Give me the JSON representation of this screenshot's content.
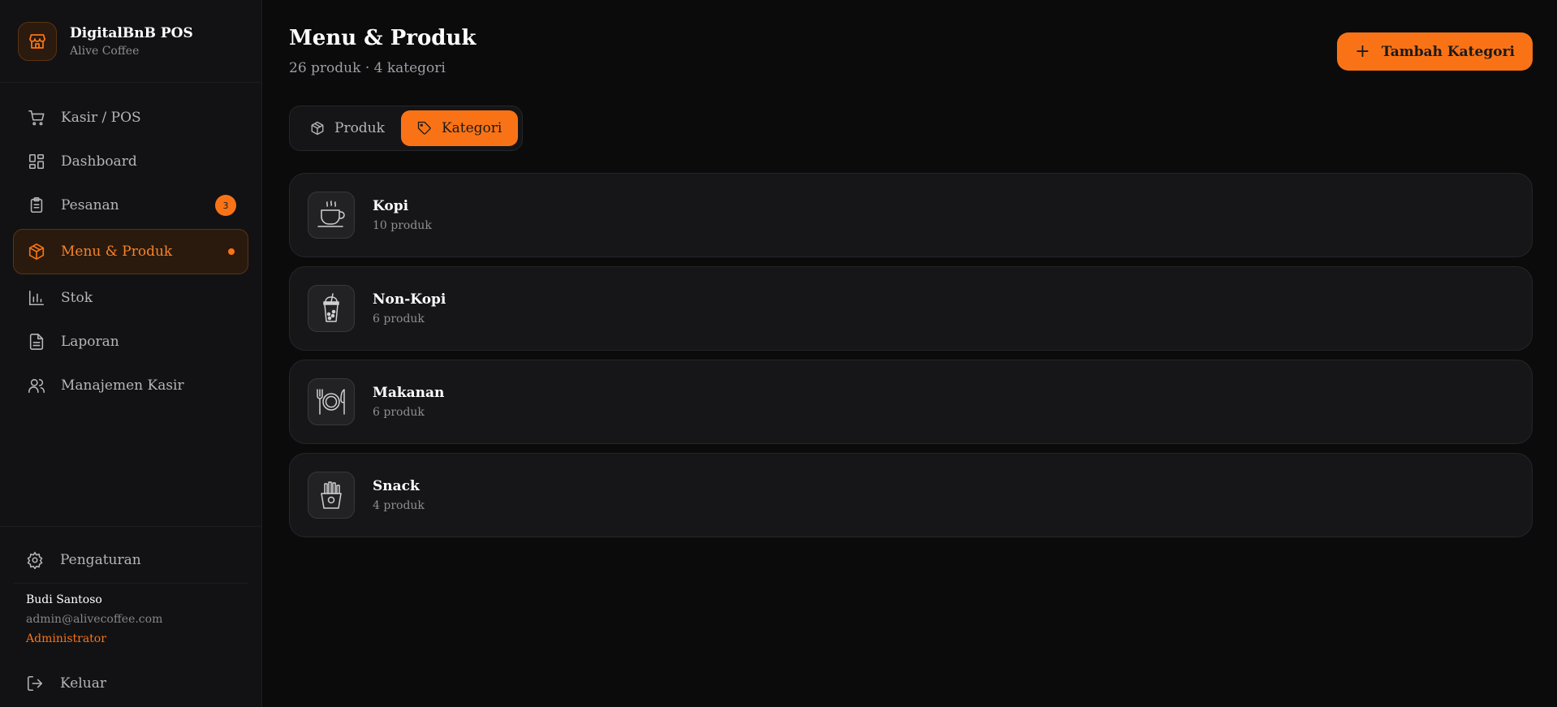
{
  "brand": {
    "title": "DigitalBnB POS",
    "subtitle": "Alive Coffee",
    "icon": "store-icon"
  },
  "nav": {
    "items": [
      {
        "label": "Kasir / POS",
        "icon": "cart-icon"
      },
      {
        "label": "Dashboard",
        "icon": "grid-icon"
      },
      {
        "label": "Pesanan",
        "icon": "clipboard-icon",
        "badge": "3"
      },
      {
        "label": "Menu & Produk",
        "icon": "box-icon",
        "active": true
      },
      {
        "label": "Stok",
        "icon": "bar-chart-icon"
      },
      {
        "label": "Laporan",
        "icon": "document-icon"
      },
      {
        "label": "Manajemen Kasir",
        "icon": "users-icon"
      }
    ]
  },
  "settings": {
    "label": "Pengaturan",
    "icon": "gear-icon"
  },
  "user": {
    "name": "Budi Santoso",
    "email": "admin@alivecoffee.com",
    "role": "Administrator"
  },
  "logout": {
    "label": "Keluar",
    "icon": "logout-icon"
  },
  "header": {
    "title": "Menu & Produk",
    "subtitle": "26 produk · 4 kategori",
    "add_label": "Tambah Kategori"
  },
  "tabs": [
    {
      "label": "Produk",
      "icon": "box-icon"
    },
    {
      "label": "Kategori",
      "icon": "tag-icon",
      "active": true
    }
  ],
  "categories": [
    {
      "name": "Kopi",
      "count": "10 produk",
      "icon": "coffee-cup-icon"
    },
    {
      "name": "Non-Kopi",
      "count": "6 produk",
      "icon": "bubble-tea-icon"
    },
    {
      "name": "Makanan",
      "count": "6 produk",
      "icon": "plate-cutlery-icon"
    },
    {
      "name": "Snack",
      "count": "4 produk",
      "icon": "fries-icon"
    }
  ],
  "colors": {
    "accent": "#f97316",
    "background": "#0b0b0c",
    "sidebar": "#121214",
    "card": "#161618"
  }
}
